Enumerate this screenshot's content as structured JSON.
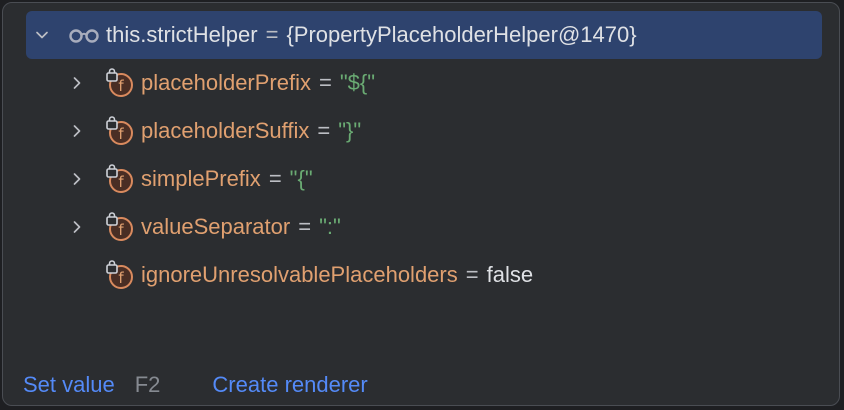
{
  "root": {
    "icon": "watch-glasses-icon",
    "expand_icon": "chevron-down-icon",
    "label": "this.strictHelper",
    "equals": "=",
    "value": "{PropertyPlaceholderHelper@1470}"
  },
  "fields": [
    {
      "name": "placeholderPrefix",
      "equals": "=",
      "value": "\"${\"",
      "value_kind": "string",
      "expandable": true
    },
    {
      "name": "placeholderSuffix",
      "equals": "=",
      "value": "\"}\"",
      "value_kind": "string",
      "expandable": true
    },
    {
      "name": "simplePrefix",
      "equals": "=",
      "value": "\"{\"",
      "value_kind": "string",
      "expandable": true
    },
    {
      "name": "valueSeparator",
      "equals": "=",
      "value": "\":\"",
      "value_kind": "string",
      "expandable": true
    },
    {
      "name": "ignoreUnresolvablePlaceholders",
      "equals": "=",
      "value": "false",
      "value_kind": "keyword",
      "expandable": false
    }
  ],
  "field_icon": "final-field-lock-icon",
  "collapsed_icon": "chevron-right-icon",
  "footer": {
    "set_value": "Set value",
    "set_value_shortcut": "F2",
    "create_renderer": "Create renderer"
  },
  "colors": {
    "background": "#2b2d30",
    "selection": "#2e436e",
    "field_name": "#e0a070",
    "string_value": "#6aab73",
    "link": "#548af7"
  }
}
